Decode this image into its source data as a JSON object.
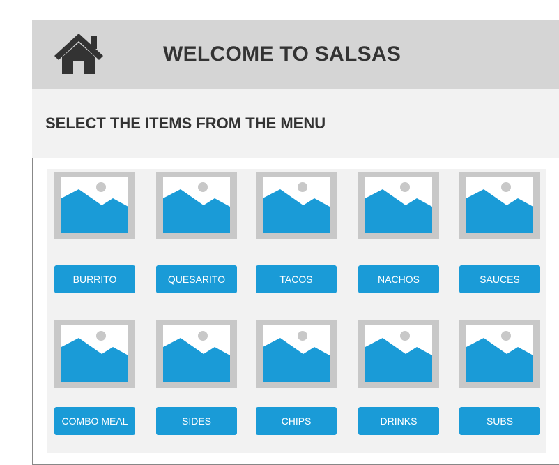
{
  "header": {
    "title": "WELCOME TO SALSAS",
    "icon": "home-icon"
  },
  "subheader": {
    "title": "SELECT THE ITEMS FROM THE MENU"
  },
  "menu": {
    "image_icon": "image-placeholder-icon",
    "items": [
      {
        "label": "BURRITO"
      },
      {
        "label": "QUESARITO"
      },
      {
        "label": "TACOS"
      },
      {
        "label": "NACHOS"
      },
      {
        "label": "SAUCES"
      },
      {
        "label": "COMBO MEAL"
      },
      {
        "label": "SIDES"
      },
      {
        "label": "CHIPS"
      },
      {
        "label": "DRINKS"
      },
      {
        "label": "SUBS"
      }
    ]
  },
  "colors": {
    "header_bg": "#d5d5d5",
    "subheader_bg": "#f2f2f2",
    "button_bg": "#1a9bd7",
    "text_dark": "#333333"
  }
}
